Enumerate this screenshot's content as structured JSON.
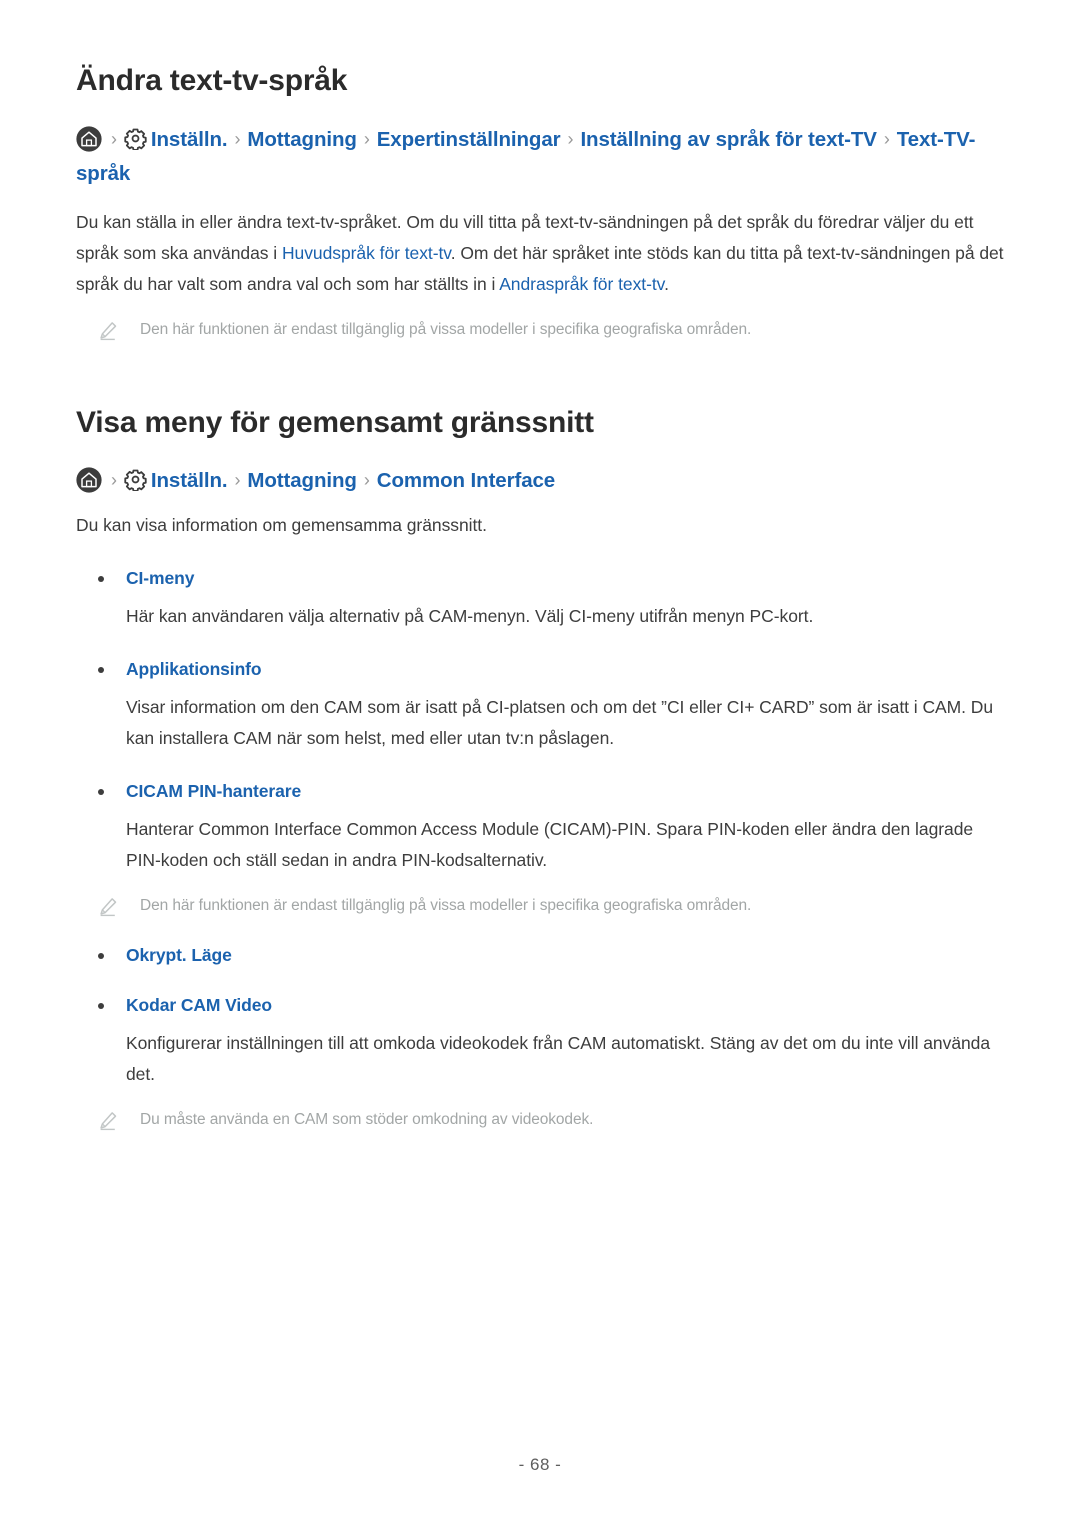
{
  "sections": [
    {
      "title": "Ändra text-tv-språk",
      "breadcrumb": {
        "home_icon": "home-icon",
        "gear_icon": "gear-icon",
        "separator": "›",
        "crumbs": [
          "Inställn.",
          "Mottagning",
          "Expertinställningar",
          "Inställning av språk för text-TV",
          "Text-TV-språk"
        ]
      },
      "paragraph": {
        "part1": "Du kan ställa in eller ändra text-tv-språket. Om du vill titta på text-tv-sändningen på det språk du föredrar väljer du ett språk som ska användas i ",
        "link1": "Huvudspråk för text-tv",
        "part2": ". Om det här språket inte stöds kan du titta på text-tv-sändningen på det språk du har valt som andra val och som har ställts in i ",
        "link2": "Andraspråk för text-tv",
        "part3": "."
      },
      "note": {
        "icon": "pencil-icon",
        "text": "Den här funktionen är endast tillgänglig på vissa modeller i specifika geografiska områden."
      }
    },
    {
      "title": "Visa meny för gemensamt gränssnitt",
      "breadcrumb": {
        "home_icon": "home-icon",
        "gear_icon": "gear-icon",
        "separator": "›",
        "crumbs": [
          "Inställn.",
          "Mottagning",
          "Common Interface"
        ]
      },
      "intro": "Du kan visa information om gemensamma gränssnitt.",
      "items": [
        {
          "label": "CI-meny",
          "description": "Här kan användaren välja alternativ på CAM-menyn. Välj CI-meny utifrån menyn PC-kort."
        },
        {
          "label": "Applikationsinfo",
          "description": "Visar information om den CAM som är isatt på CI-platsen och om det ”CI eller CI+ CARD” som är isatt i CAM. Du kan installera CAM när som helst, med eller utan tv:n påslagen."
        },
        {
          "label": "CICAM PIN-hanterare",
          "description": "Hanterar Common Interface Common Access Module (CICAM)-PIN. Spara PIN-koden eller ändra den lagrade PIN-koden och ställ sedan in andra PIN-kodsalternativ."
        }
      ],
      "note": {
        "icon": "pencil-icon",
        "text": "Den här funktionen är endast tillgänglig på vissa modeller i specifika geografiska områden."
      },
      "items2": [
        {
          "label": "Okrypt. Läge",
          "description": ""
        },
        {
          "label": "Kodar CAM Video",
          "description": "Konfigurerar inställningen till att omkoda videokodek från CAM automatiskt. Stäng av det om du inte vill använda det."
        }
      ],
      "note2": {
        "icon": "pencil-icon",
        "text": "Du måste använda en CAM som stöder omkodning av videokodek."
      }
    }
  ],
  "footer": {
    "page_number": "- 68 -"
  },
  "colors": {
    "link": "#1b62ae",
    "text": "#3d3d3d",
    "note": "#a2a6a6",
    "separator": "#9a9a9a"
  }
}
